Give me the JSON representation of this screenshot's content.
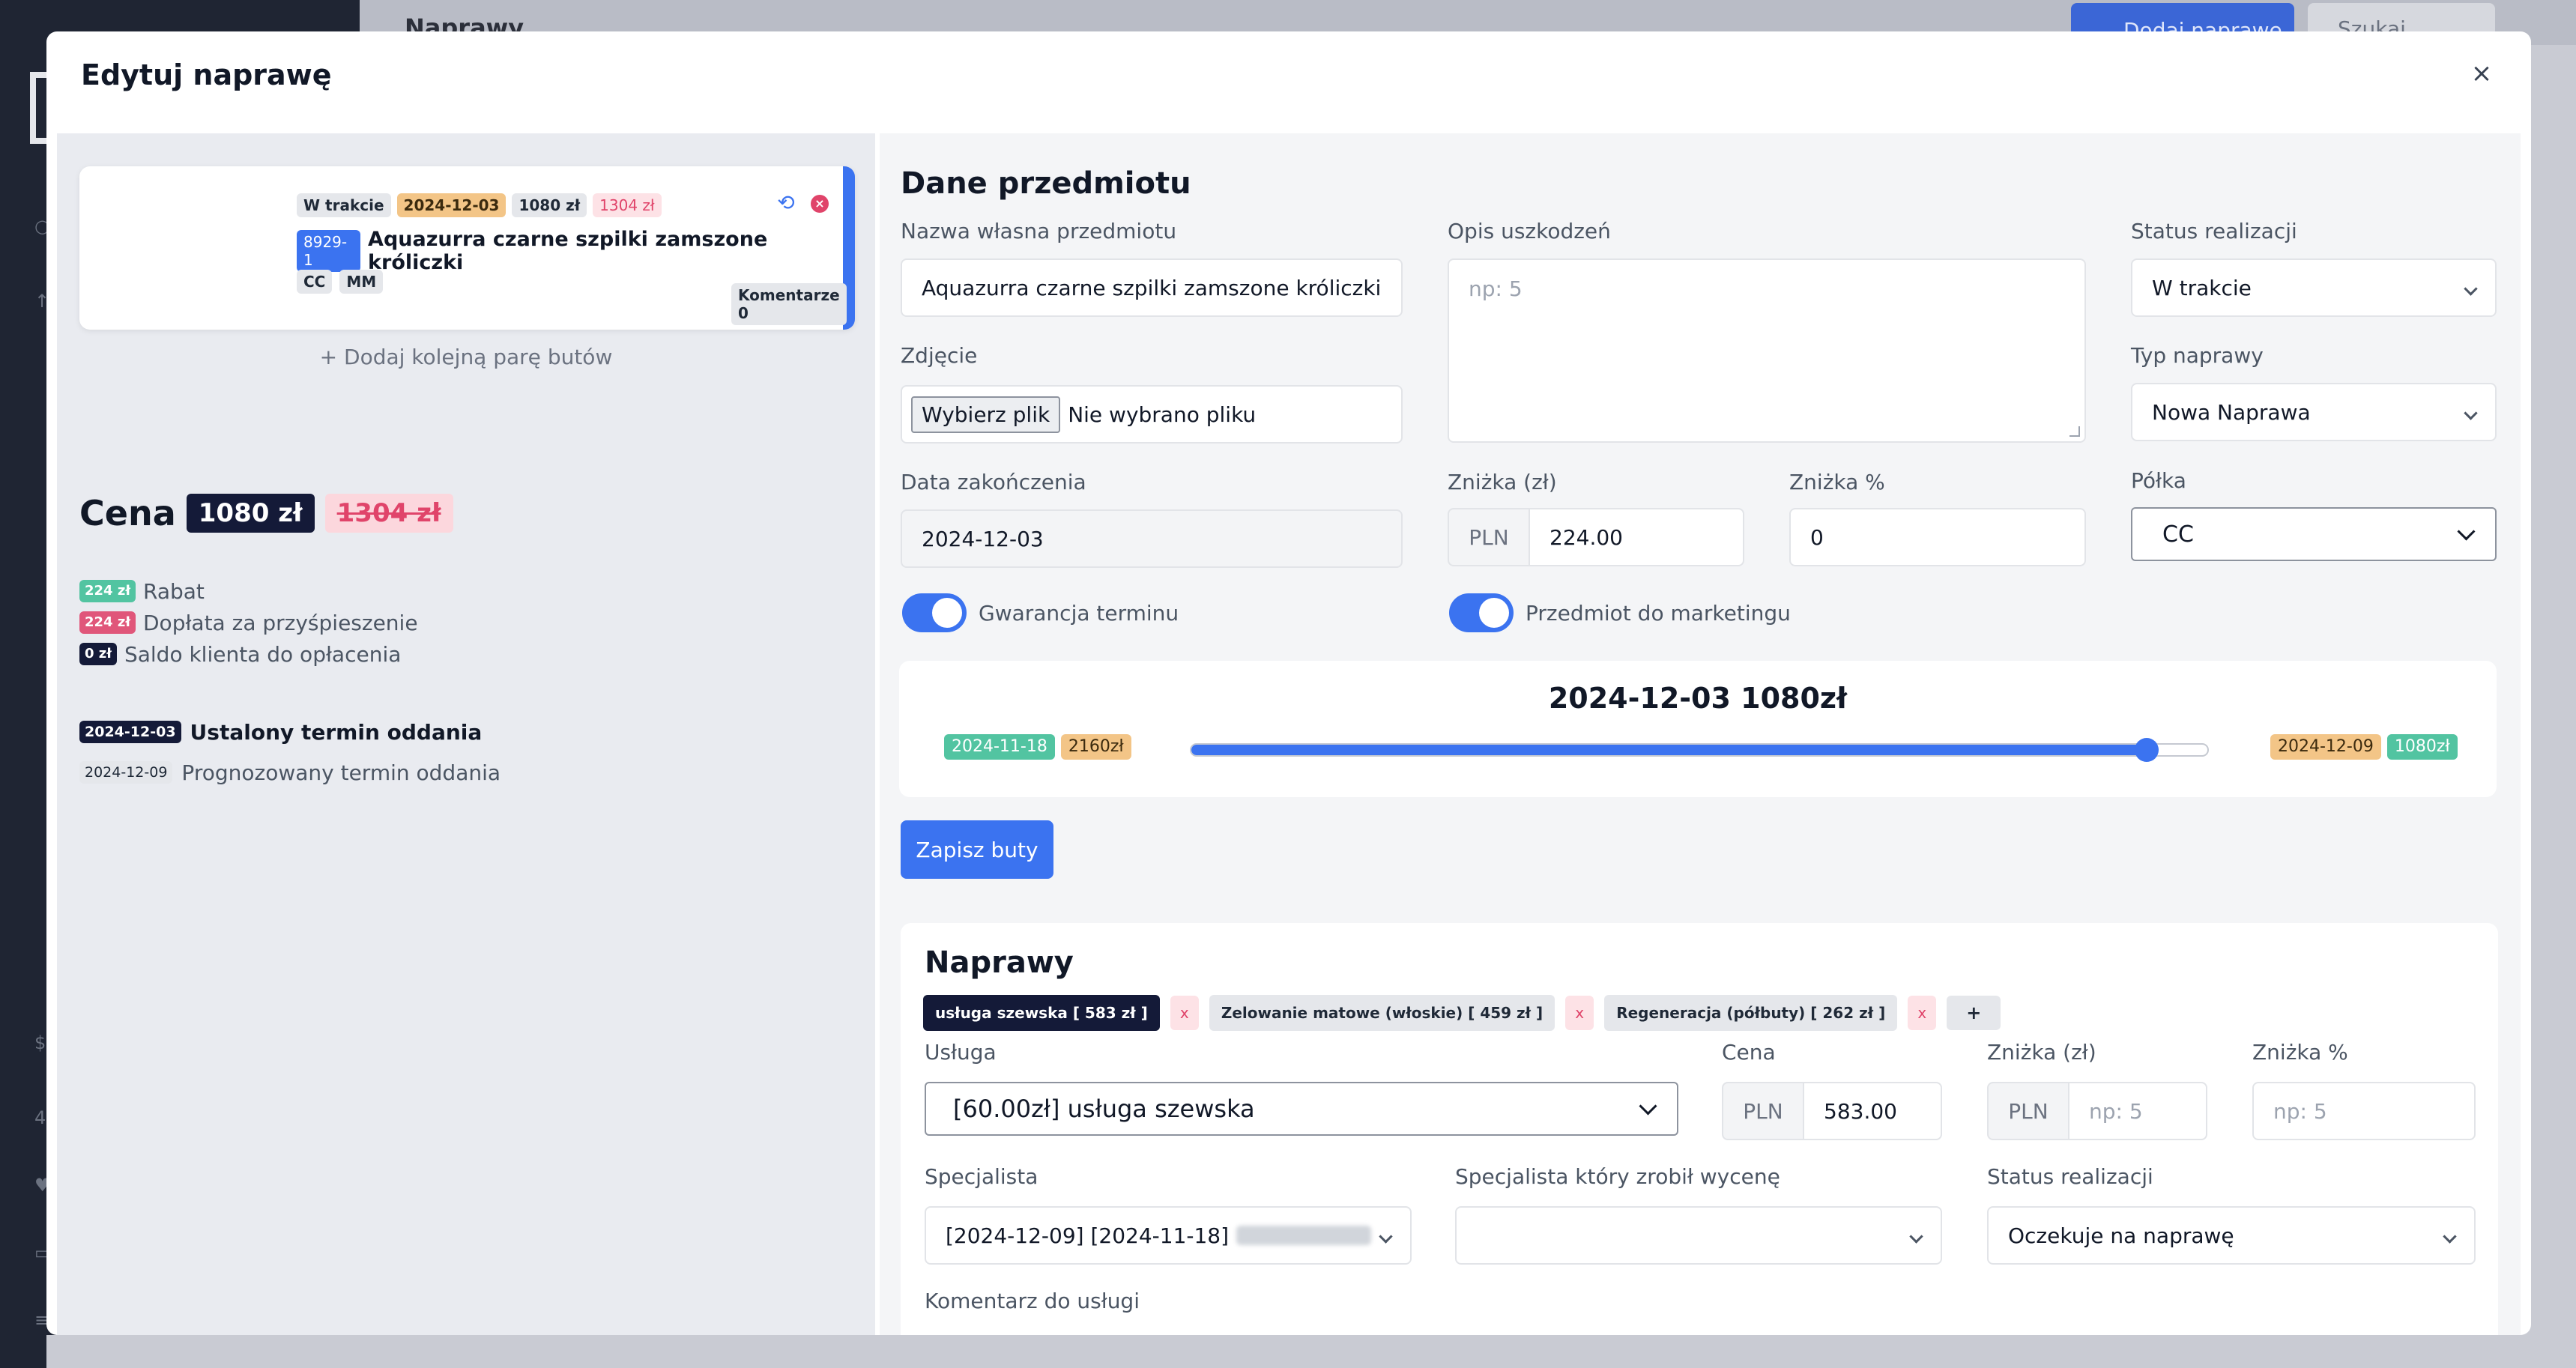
{
  "background": {
    "page_title": "Naprawy",
    "add_button": "Dodaj naprawę",
    "search_button": "Szukaj"
  },
  "modal": {
    "title": "Edytuj naprawę",
    "close": "×"
  },
  "shoe_card": {
    "status": "W trakcie",
    "date": "2024-12-03",
    "price": "1080 zł",
    "old_price": "1304 zł",
    "id": "8929-1",
    "name": "Aquazurra czarne szpilki zamszone króliczki",
    "tags": [
      "CC",
      "MM"
    ],
    "comments": "Komentarze 0"
  },
  "add_pair": "+ Dodaj kolejną parę butów",
  "price": {
    "label": "Cena",
    "current": "1080 zł",
    "old": "1304 zł"
  },
  "details": [
    {
      "amount": "224 zł",
      "label": "Rabat",
      "color": "#52c4a1"
    },
    {
      "amount": "224 zł",
      "label": "Dopłata za przyśpieszenie",
      "color": "#e0567a"
    },
    {
      "amount": "0 zł",
      "label": "Saldo klienta do opłacenia",
      "color": "#141a38"
    }
  ],
  "terms": [
    {
      "date": "2024-12-03",
      "label": "Ustalony termin oddania"
    },
    {
      "date": "2024-12-09",
      "label": "Prognozowany termin oddania"
    }
  ],
  "item_form": {
    "section_title": "Dane przedmiotu",
    "name_label": "Nazwa własna przedmiotu",
    "name_value": "Aquazurra czarne szpilki zamszone króliczki",
    "damage_label": "Opis uszkodzeń",
    "damage_placeholder": "np: 5",
    "status_label": "Status realizacji",
    "status_value": "W trakcie",
    "photo_label": "Zdjęcie",
    "file_button": "Wybierz plik",
    "file_status": "Nie wybrano pliku",
    "type_label": "Typ naprawy",
    "type_value": "Nowa Naprawa",
    "end_date_label": "Data zakończenia",
    "end_date_value": "2024-12-03",
    "discount_pln_label": "Zniżka (zł)",
    "currency": "PLN",
    "discount_pln_value": "224.00",
    "discount_pct_label": "Zniżka %",
    "discount_pct_value": "0",
    "shelf_label": "Półka",
    "shelf_value": "CC",
    "guarantee_label": "Gwarancja terminu",
    "guarantee_on": true,
    "marketing_label": "Przedmiot do marketingu",
    "marketing_on": true
  },
  "slider": {
    "title": "2024-12-03 1080zł",
    "min_date": "2024-11-18",
    "min_price": "2160zł",
    "max_date": "2024-12-09",
    "max_price": "1080zł",
    "value_fraction": 0.94
  },
  "save_button": "Zapisz buty",
  "repairs": {
    "title": "Naprawy",
    "services": [
      {
        "label": "usługa szewska [ 583 zł ]",
        "active": true
      },
      {
        "label": "Zelowanie matowe (włoskie) [ 459 zł ]",
        "active": false
      },
      {
        "label": "Regeneracja (półbuty) [ 262 zł ]",
        "active": false
      }
    ],
    "remove_symbol": "x",
    "add_symbol": "+",
    "service_label": "Usługa",
    "service_value": "[60.00zł] usługa szewska",
    "price_label": "Cena",
    "currency": "PLN",
    "price_value": "583.00",
    "discount_pln_label": "Zniżka (zł)",
    "discount_pln_placeholder": "np: 5",
    "discount_pct_label": "Zniżka %",
    "discount_pct_placeholder": "np: 5",
    "specialist_label": "Specjalista",
    "specialist_value": "[2024-12-09] [2024-11-18]",
    "estimator_label": "Specjalista który zrobił wycenę",
    "estimator_value": "",
    "status_label": "Status realizacji",
    "status_value": "Oczekuje na naprawę",
    "comment_label": "Komentarz do usługi"
  }
}
